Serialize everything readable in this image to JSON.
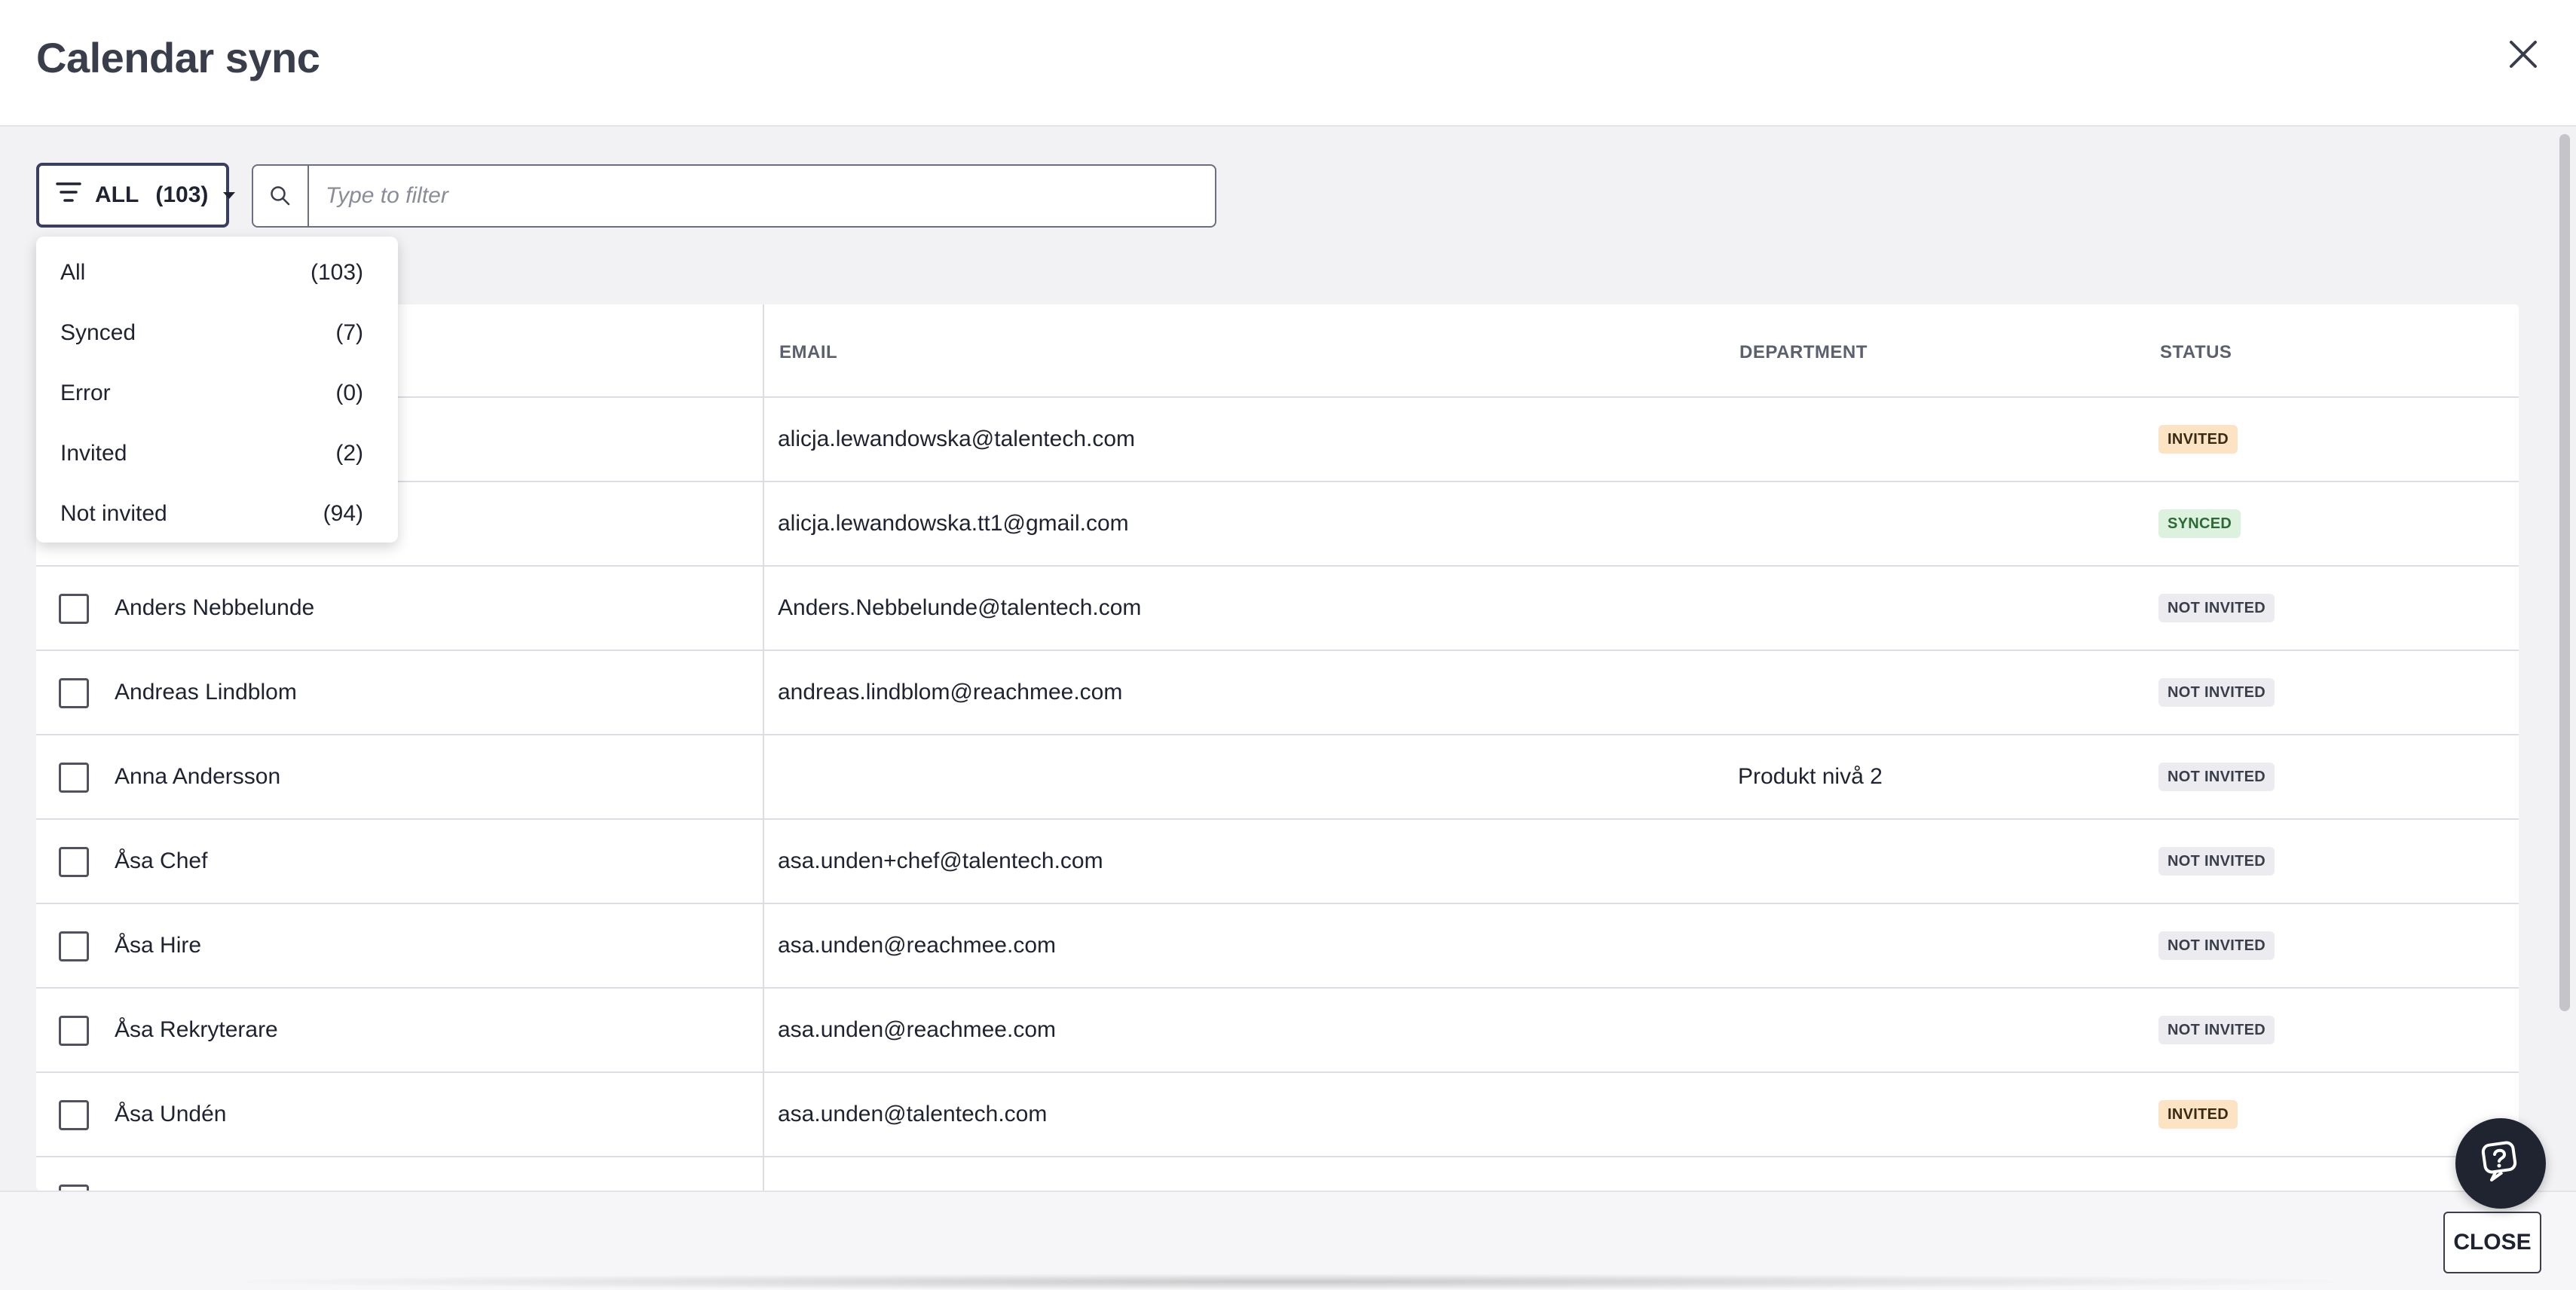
{
  "header": {
    "title": "Calendar sync"
  },
  "filter": {
    "label": "ALL",
    "count": "(103)",
    "options": [
      {
        "label": "All",
        "count": "(103)"
      },
      {
        "label": "Synced",
        "count": "(7)"
      },
      {
        "label": "Error",
        "count": "(0)"
      },
      {
        "label": "Invited",
        "count": "(2)"
      },
      {
        "label": "Not invited",
        "count": "(94)"
      }
    ]
  },
  "search": {
    "placeholder": "Type to filter",
    "value": ""
  },
  "table": {
    "headers": {
      "email": "EMAIL",
      "department": "DEPARTMENT",
      "status": "STATUS"
    },
    "rows": [
      {
        "name": "",
        "email": "alicja.lewandowska@talentech.com",
        "department": "",
        "status": "INVITED"
      },
      {
        "name": "",
        "email": "alicja.lewandowska.tt1@gmail.com",
        "department": "",
        "status": "SYNCED"
      },
      {
        "name": "Anders Nebbelunde",
        "email": "Anders.Nebbelunde@talentech.com",
        "department": "",
        "status": "NOT INVITED"
      },
      {
        "name": "Andreas Lindblom",
        "email": "andreas.lindblom@reachmee.com",
        "department": "",
        "status": "NOT INVITED"
      },
      {
        "name": "Anna Andersson",
        "email": "",
        "department": "Produkt nivå 2",
        "status": "NOT INVITED"
      },
      {
        "name": "Åsa Chef",
        "email": "asa.unden+chef@talentech.com",
        "department": "",
        "status": "NOT INVITED"
      },
      {
        "name": "Åsa Hire",
        "email": "asa.unden@reachmee.com",
        "department": "",
        "status": "NOT INVITED"
      },
      {
        "name": "Åsa Rekryterare",
        "email": "asa.unden@reachmee.com",
        "department": "",
        "status": "NOT INVITED"
      },
      {
        "name": "Åsa Undén",
        "email": "asa.unden@talentech.com",
        "department": "",
        "status": "INVITED"
      }
    ]
  },
  "footer": {
    "close_label": "CLOSE"
  },
  "colors": {
    "accent_border": "#3a3f62",
    "invited_bg": "#fbe3c4",
    "synced_bg": "#ddf1df",
    "not_invited_bg": "#ececf0"
  },
  "icons": {
    "close": "close-icon",
    "filter": "filter-lines-icon",
    "search": "search-icon",
    "chat": "chat-help-icon"
  }
}
